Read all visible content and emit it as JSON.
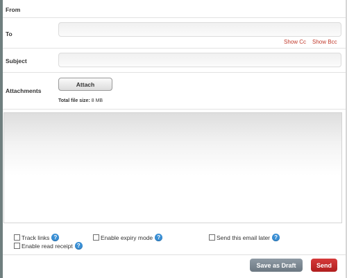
{
  "from": {
    "label": "From"
  },
  "to": {
    "label": "To",
    "value": "",
    "show_cc": "Show Cc",
    "show_bcc": "Show Bcc"
  },
  "subject": {
    "label": "Subject",
    "value": ""
  },
  "attachments": {
    "label": "Attachments",
    "attach_button": "Attach",
    "total_size_label": "Total file size:",
    "total_size_value": "8 MB"
  },
  "options": {
    "track_links": "Track links",
    "enable_expiry": "Enable expiry mode",
    "send_later": "Send this email later",
    "read_receipt": "Enable read receipt",
    "help_glyph": "?"
  },
  "actions": {
    "save_draft": "Save as Draft",
    "send": "Send"
  },
  "colors": {
    "accent_red": "#c0392b",
    "help_blue": "#3a8fd4",
    "draft_grey": "#7a8690"
  }
}
